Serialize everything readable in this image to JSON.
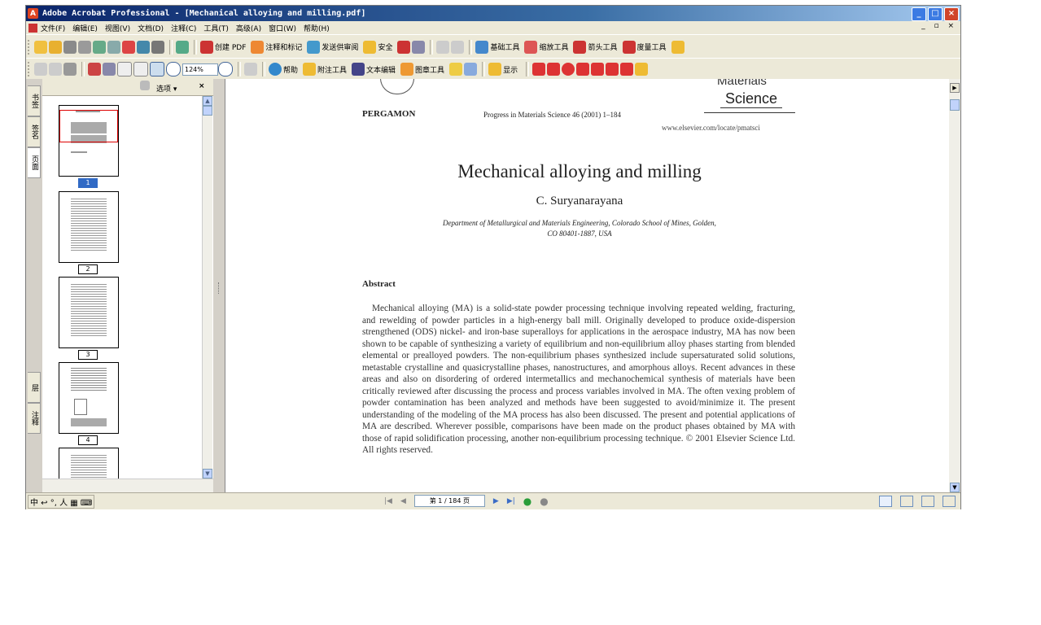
{
  "window": {
    "title": "Adobe Acrobat Professional - [Mechanical alloying and milling.pdf]",
    "minimize": "_",
    "maximize": "□",
    "close": "×"
  },
  "menubar": {
    "items": [
      "文件(F)",
      "编辑(E)",
      "视图(V)",
      "文档(D)",
      "注释(C)",
      "工具(T)",
      "高级(A)",
      "窗口(W)",
      "帮助(H)"
    ],
    "right_controls": "_ ▫ ×"
  },
  "toolbar1": {
    "create_pdf": "创建 PDF",
    "annotate": "注释和标记",
    "send_review": "发送供审阅",
    "secure": "安全",
    "basic_tools": "基础工具",
    "zoom_tools": "缩放工具",
    "arrow_tools": "箭头工具",
    "measure_tools": "度量工具"
  },
  "toolbar2": {
    "zoom_value": "124%",
    "help": "帮助",
    "comment_tools": "附注工具",
    "text_edit": "文本编辑",
    "drawing_tools": "图章工具",
    "show": "显示"
  },
  "sidetabs": {
    "top": [
      "书签",
      "签名",
      "页面"
    ],
    "bottom": [
      "层",
      "注释"
    ]
  },
  "panel": {
    "options_label": "选项 ▾",
    "close_label": "×",
    "thumbnails": [
      {
        "label": "1",
        "selected": true
      },
      {
        "label": "2",
        "selected": false
      },
      {
        "label": "3",
        "selected": false
      },
      {
        "label": "4",
        "selected": false
      }
    ]
  },
  "document": {
    "publisher": "PERGAMON",
    "journal_line": "Progress in Materials Science 46 (2001) 1–184",
    "journal_logo_top": "Materials",
    "journal_logo": "Science",
    "journal_url": "www.elsevier.com/locate/pmatsci",
    "title": "Mechanical alloying and milling",
    "author": "C. Suryanarayana",
    "affiliation_line1": "Department of Metallurgical and Materials Engineering, Colorado School of Mines, Golden,",
    "affiliation_line2": "CO 80401-1887, USA",
    "abstract_heading": "Abstract",
    "abstract_text": "Mechanical alloying (MA) is a solid-state powder processing technique involving repeated welding, fracturing, and rewelding of powder particles in a high-energy ball mill. Originally developed to produce oxide-dispersion strengthened (ODS) nickel- and iron-base superalloys for applications in the aerospace industry, MA has now been shown to be capable of synthesizing a variety of equilibrium and non-equilibrium alloy phases starting from blended elemental or prealloyed powders. The non-equilibrium phases synthesized include supersaturated solid solutions, metastable crystalline and quasicrystalline phases, nanostructures, and amorphous alloys. Recent advances in these areas and also on disordering of ordered intermetallics and mechanochemical synthesis of materials have been critically reviewed after discussing the process and process variables involved in MA. The often vexing problem of powder contamination has been analyzed and methods have been suggested to avoid/minimize it. The present understanding of the modeling of the MA process has also been discussed. The present and potential applications of MA are described. Wherever possible, comparisons have been made on the product phases obtained by MA with those of rapid solidification processing, another non-equilibrium processing technique. © 2001 Elsevier Science Ltd. All rights reserved."
  },
  "statusbar": {
    "ime": "中 ↩ °, 人 ▦ ⌨",
    "page_indicator": "第 1 / 184 页"
  }
}
